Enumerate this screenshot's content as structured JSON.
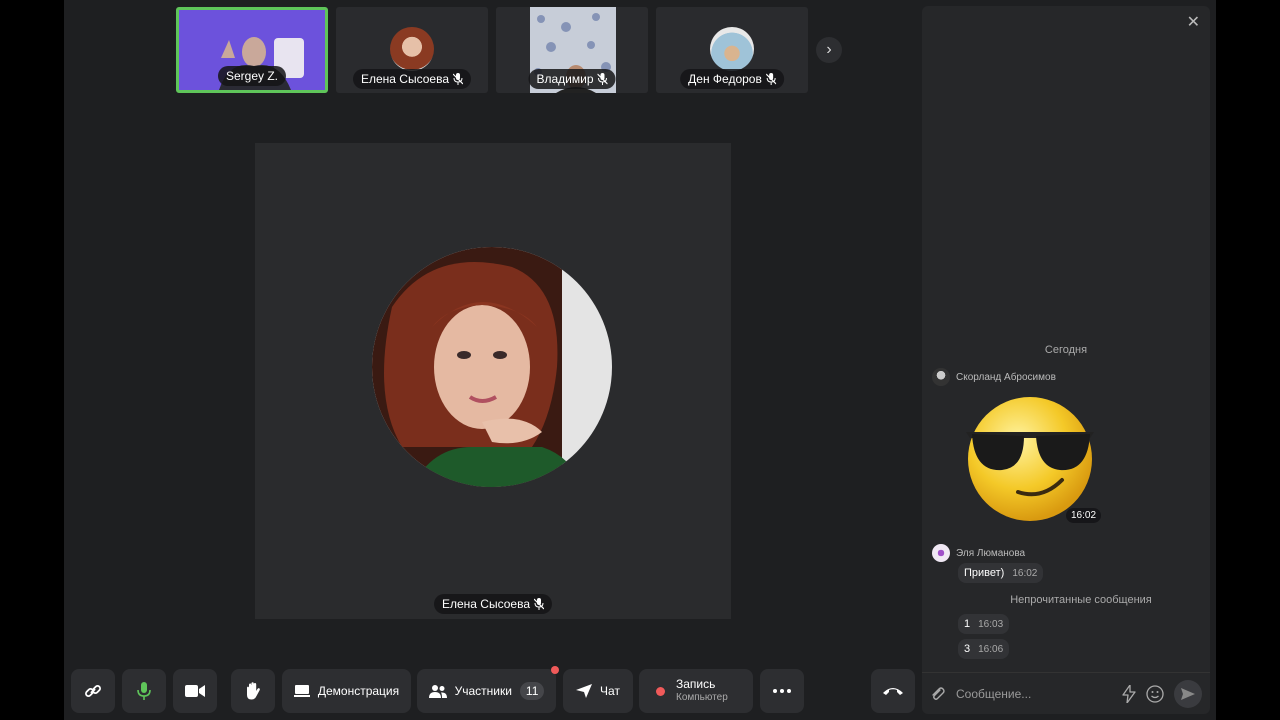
{
  "thumbnails": [
    {
      "name": "Sergey Z."
    },
    {
      "name": "Елена Сысоева"
    },
    {
      "name": "Владимир"
    },
    {
      "name": "Ден Федоров"
    }
  ],
  "main": {
    "name": "Елена Сысоева"
  },
  "toolbar": {
    "demo_label": "Демонстрация",
    "participants_label": "Участники",
    "participants_count": "11",
    "chat_label": "Чат",
    "record_label": "Запись",
    "record_sub": "Компьютер"
  },
  "chat": {
    "date": "Сегодня",
    "messages": [
      {
        "sender": "Скорланд Абросимов",
        "time": "16:02"
      },
      {
        "sender": "Эля Люманова",
        "text": "Привет)",
        "time": "16:02"
      }
    ],
    "unread_label": "Непрочитанные сообщения",
    "unread": [
      {
        "text": "1",
        "time": "16:03"
      },
      {
        "text": "3",
        "time": "16:06"
      }
    ],
    "placeholder": "Сообщение..."
  },
  "colors": {
    "active_border": "#5fc55a",
    "record_dot": "#f05a5a",
    "mic_on": "#5fc55a"
  },
  "icons": [
    "link-icon",
    "mic-icon",
    "camera-icon",
    "hand-icon",
    "screen-icon",
    "people-icon",
    "send-icon",
    "more-icon",
    "hangup-icon",
    "attach-icon",
    "lightning-icon",
    "emoji-icon",
    "mic-off-icon",
    "chevron-right-icon",
    "close-icon"
  ]
}
